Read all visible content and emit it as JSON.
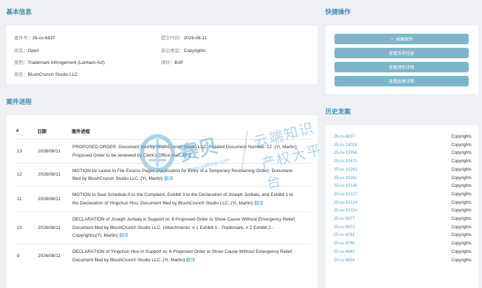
{
  "basic": {
    "title": "基本信息",
    "case_no_label": "案件号：",
    "case_no": "26-cv-6837",
    "submit_label": "提交时间：",
    "submit": "2026-08-11",
    "status_label": "状态：",
    "status": "Open",
    "type_label": "诉讼类型：",
    "type": "Copyrights",
    "cause_label": "原因：",
    "cause": "Trademark Infringement (Lanham Act)",
    "lawyer_label": "律所：",
    "lawyer": "BSF",
    "plaintiff_label": "原告：",
    "plaintiff": "BlushCrunch Studio LLC"
  },
  "quick": {
    "title": "快捷操作",
    "buttons": [
      "收藏案件",
      "查看诉状信息",
      "查看律所详情",
      "查看品牌详情"
    ]
  },
  "progress": {
    "title": "案件进程",
    "headers": [
      "#",
      "日期",
      "案件进程"
    ],
    "translate": "翻译",
    "rows": [
      {
        "num": "13",
        "date": "2026/08/11",
        "l1": "PROPOSED ORDER. Document filed by BlushCrunch Studio LLC. Related Document Number: 12 .(Yi, Martin)",
        "l2": "Proposed Order to be reviewed by Clerk's Office staff."
      },
      {
        "num": "12",
        "date": "2026/08/11",
        "l1": "MOTION for Leave to File Excess Pages (Application for Entry of a Temporary Restraining Order). Document",
        "l2": "filed by BlushCrunch Studio LLC..(Yi, Martin)"
      },
      {
        "num": "11",
        "date": "2026/08/11",
        "l1": "MOTION to Seal Schedule A to the Complaint, Exhibit 3 to the Declaration of Joseph Jurbala, and Exhibit 1 to",
        "l2": "the Declaration of Yingchun Hou. Document filed by BlushCrunch Studio LLC..(Yi, Martin)"
      },
      {
        "num": "10",
        "date": "2026/08/11",
        "l1": "DECLARATION of Joseph Jurbala in Support re: 6 Proposed Order to Show Cause Without Emergency Relief.",
        "l2": "Document filed by BlushCrunch Studio LLC. (Attachments: # 1 Exhibit 1 - Trademark, # 2 Exhibit 2 -",
        "l3": "Copyrights)(Yi, Martin)"
      },
      {
        "num": "9",
        "date": "2026/08/11",
        "l1": "DECLARATION of Yingchun Hou in Support re: 6 Proposed Order to Show Cause Without Emergency Relief.",
        "l2": "Document filed by BlushCrunch Studio LLC..(Yi, Martin)"
      }
    ]
  },
  "history": {
    "title": "历史发案",
    "items": [
      {
        "case": "26-cv-6837",
        "type": "Copyrights"
      },
      {
        "case": "25-cv-14016",
        "type": "Copyrights"
      },
      {
        "case": "25-cv-13956",
        "type": "Copyrights"
      },
      {
        "case": "25-cv-10470",
        "type": "Copyrights"
      },
      {
        "case": "25-cv-10263",
        "type": "Copyrights"
      },
      {
        "case": "25-cv-10261",
        "type": "Copyrights"
      },
      {
        "case": "25-cv-10136",
        "type": "Copyrights"
      },
      {
        "case": "25-cv-10127",
        "type": "Copyrights"
      },
      {
        "case": "25-cv-10124",
        "type": "Copyrights"
      },
      {
        "case": "25-cv-10114",
        "type": "Copyrights"
      },
      {
        "case": "25-cv-9977",
        "type": "Copyrights"
      },
      {
        "case": "25-cv-9973",
        "type": "Copyrights"
      },
      {
        "case": "25-cv-9761",
        "type": "Copyrights"
      },
      {
        "case": "25-cv-9760",
        "type": "Copyrights"
      },
      {
        "case": "25-cv-9640",
        "type": "Copyrights"
      },
      {
        "case": "25-cv-9634",
        "type": "Copyrights"
      }
    ]
  },
  "watermark": {
    "brand": "赛贝",
    "slogan1": "云端知识",
    "slogan2": "产权大平台",
    "url": "www.saibeip.com"
  }
}
